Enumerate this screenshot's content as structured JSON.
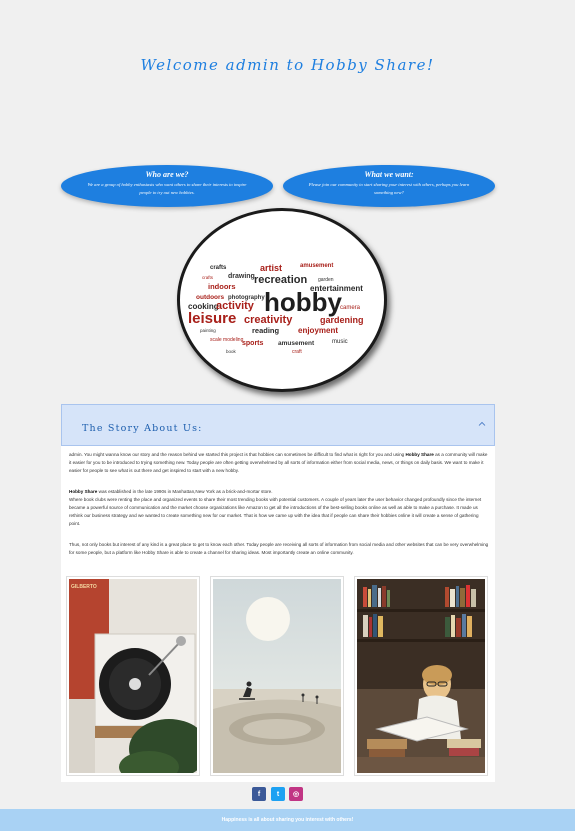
{
  "header": {
    "welcome": "Welcome admin to Hobby Share!"
  },
  "cards": {
    "who": {
      "title": "Who are we?",
      "body": "We are a group of hobby enthusiasts who want others to share their interests to inspire people to try out new hobbies."
    },
    "want": {
      "title": "What we want:",
      "body": "Please join our community to start sharing your interest with others, perhaps you learn something new?"
    }
  },
  "wordcloud": {
    "words": [
      "hobby",
      "recreation",
      "leisure",
      "activity",
      "creativity",
      "entertainment",
      "photography",
      "gardening",
      "reading",
      "artist",
      "crafts",
      "drawing",
      "indoors",
      "outdoors",
      "cooking",
      "camera",
      "painting",
      "scale modeling",
      "sports",
      "amusement",
      "enjoyment",
      "music",
      "craft",
      "garden",
      "book"
    ]
  },
  "story": {
    "title": "The Story About Us:",
    "p1_a": "admin. You might wanna know our story and the reason behind we started this project is that hobbies can sometimes be difficult to find what is right for you and using ",
    "brand": "Hobby Share",
    "p1_b": " as a community will make it easier for you to be introduced to trying something new. Today people are often getting overwhelmed by all sorts of information either from social media, news, or things on daily basis. We want to make it easier for people to see what is out there and get inspired to start with a new hobby.",
    "p2_a": " was established in the late 1990s in Manhattan,New York as a brick-and-mortar store.",
    "p2_b": "Where book clubs were renting the place and organized events to share their most trending books with potential customers. A couple of years later the user behavior changed profoundly since the internet became a powerful source of communication and the market choose organizations like Amazon to get all the introductions of the best-selling books online as well as able to make a purchase. It made us rethink our business strategy and we wanted to create something new for our market. That is how we came up with the idea that if people can share their hobbies online it will create a sense of gathering point.",
    "p3": "Thus, not only books but interest of any kind is a great place to get to know each other. Today people are receiving all sorts of information from social media and other websites that can be very overwhelming for some people, but a platform like Hobby Share is able to create a channel for sharing ideas. Most importantly create an online community.",
    "record_label": "GILBERTO"
  },
  "social": {
    "facebook": "f",
    "twitter": "t",
    "instagram": "◎"
  },
  "footer": {
    "text": "Happiness is all about sharing you interest with others!"
  },
  "colors": {
    "accent": "#1e7fe0",
    "footer": "#a9d2f4",
    "header_band": "#d6e4f9"
  }
}
